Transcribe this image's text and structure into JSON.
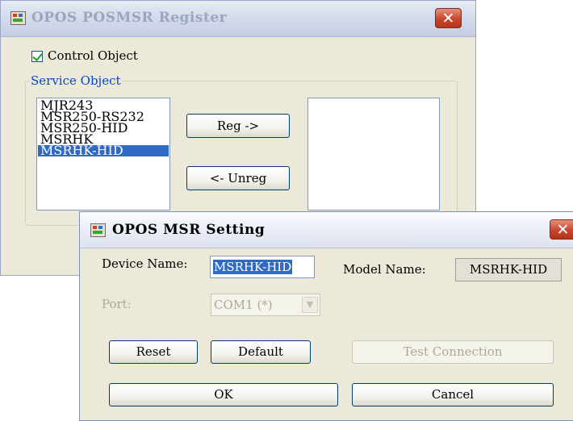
{
  "register_window": {
    "title": "OPOS POSMSR Register",
    "close_glyph": "✕",
    "control_object": {
      "label": "Control Object",
      "checked": true
    },
    "service_object_group": "Service Object",
    "service_objects": [
      "MJR243",
      "MSR250-RS232",
      "MSR250-HID",
      "MSRHK",
      "MSRHK-HID"
    ],
    "selected_service_object": "MSRHK-HID",
    "registered_objects": [],
    "reg_button": "Reg ->",
    "unreg_button": "<- Unreg"
  },
  "setting_dialog": {
    "title": "OPOS MSR Setting",
    "close_glyph": "✕",
    "device_name_label": "Device Name:",
    "device_name_value": "MSRHK-HID",
    "model_name_label": "Model Name:",
    "model_name_value": "MSRHK-HID",
    "port_label": "Port:",
    "port_value": "COM1 (*)",
    "port_arrow": "▼",
    "reset_button": "Reset",
    "default_button": "Default",
    "test_button": "Test Connection",
    "ok_button": "OK",
    "cancel_button": "Cancel"
  },
  "colors": {
    "selection": "#316ac5",
    "group_title": "#0046d5",
    "dialog_face": "#ece9d8",
    "close_button": "#c8452c",
    "check_green": "#21a121"
  }
}
